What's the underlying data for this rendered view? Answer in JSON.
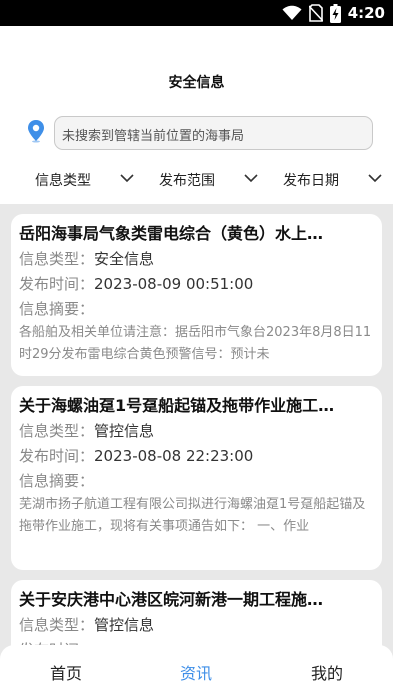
{
  "status_bar": {
    "time": "4:20"
  },
  "header": {
    "title": "安全信息",
    "search_placeholder": "未搜索到管辖当前位置的海事局"
  },
  "filters": [
    {
      "label": "信息类型"
    },
    {
      "label": "发布范围"
    },
    {
      "label": "发布日期"
    }
  ],
  "field_labels": {
    "type": "信息类型：",
    "time": "发布时间：",
    "summary": "信息摘要："
  },
  "items": [
    {
      "title": "岳阳海事局气象类雷电综合（黄色）水上…",
      "type": "安全信息",
      "time": "2023-08-09 00:51:00",
      "summary": "各船舶及相关单位请注意：据岳阳市气象台2023年8月8日11时29分发布雷电综合黄色预警信号：预计未"
    },
    {
      "title": "关于海螺油趸1号趸船起锚及拖带作业施工…",
      "type": "管控信息",
      "time": "2023-08-08 22:23:00",
      "summary": "芜湖市扬子航道工程有限公司拟进行海螺油趸1号趸船起锚及拖带作业施工，现将有关事项通告如下：  一、作业"
    },
    {
      "title": "关于安庆港中心港区皖河新港一期工程施…",
      "type": "管控信息",
      "time": "",
      "summary": ""
    }
  ],
  "tabbar": {
    "tabs": [
      {
        "label": "首页"
      },
      {
        "label": "资讯"
      },
      {
        "label": "我的"
      }
    ],
    "active_color": "#3f8fe8"
  },
  "colors": {
    "accent": "#3f8fe8",
    "list_background": "#e8e8e8"
  }
}
